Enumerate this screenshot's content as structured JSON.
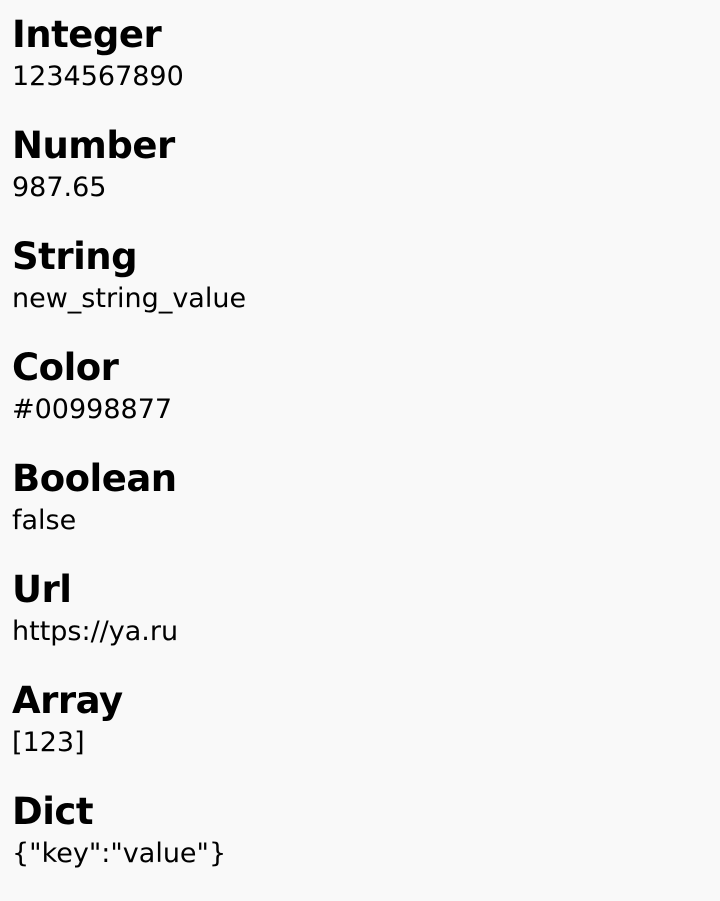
{
  "properties": [
    {
      "title": "Integer",
      "value": "1234567890"
    },
    {
      "title": "Number",
      "value": "987.65"
    },
    {
      "title": "String",
      "value": "new_string_value"
    },
    {
      "title": "Color",
      "value": "#00998877"
    },
    {
      "title": "Boolean",
      "value": "false"
    },
    {
      "title": "Url",
      "value": "https://ya.ru"
    },
    {
      "title": "Array",
      "value": "[123]"
    },
    {
      "title": "Dict",
      "value": "{\"key\":\"value\"}"
    }
  ]
}
